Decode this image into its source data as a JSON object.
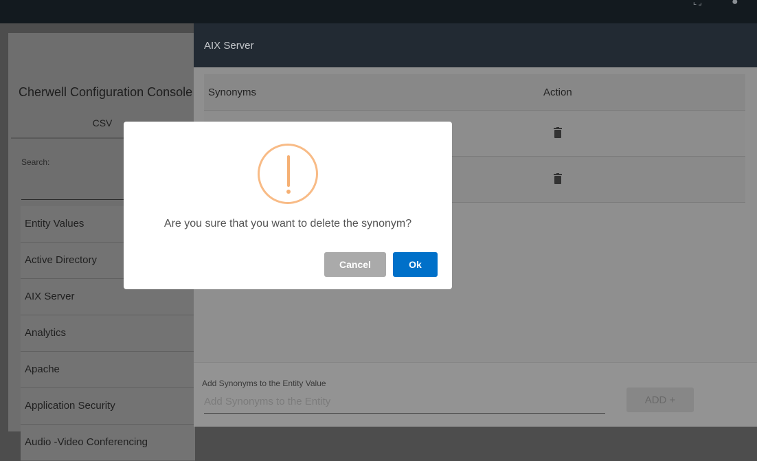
{
  "topbar": {
    "icons": [
      "fullscreen-icon",
      "user-account-icon"
    ]
  },
  "sidebar": {
    "title": "Cherwell Configuration Console",
    "tab": "CSV",
    "search_label": "Search:",
    "items": [
      "Entity Values",
      "Active Directory",
      "AIX Server",
      "Analytics",
      "Apache",
      "Application Security",
      "Audio -Video Conferencing"
    ]
  },
  "panel": {
    "title": "AIX Server",
    "columns": [
      "Synonyms",
      "Action"
    ],
    "rows": [
      "",
      ""
    ],
    "add_label": "Add Synonyms to the Entity Value",
    "add_placeholder": "Add Synonyms to the Entity",
    "add_button": "ADD +"
  },
  "dialog": {
    "message": "Are you sure that you want to delete the synonym?",
    "cancel": "Cancel",
    "ok": "Ok"
  }
}
